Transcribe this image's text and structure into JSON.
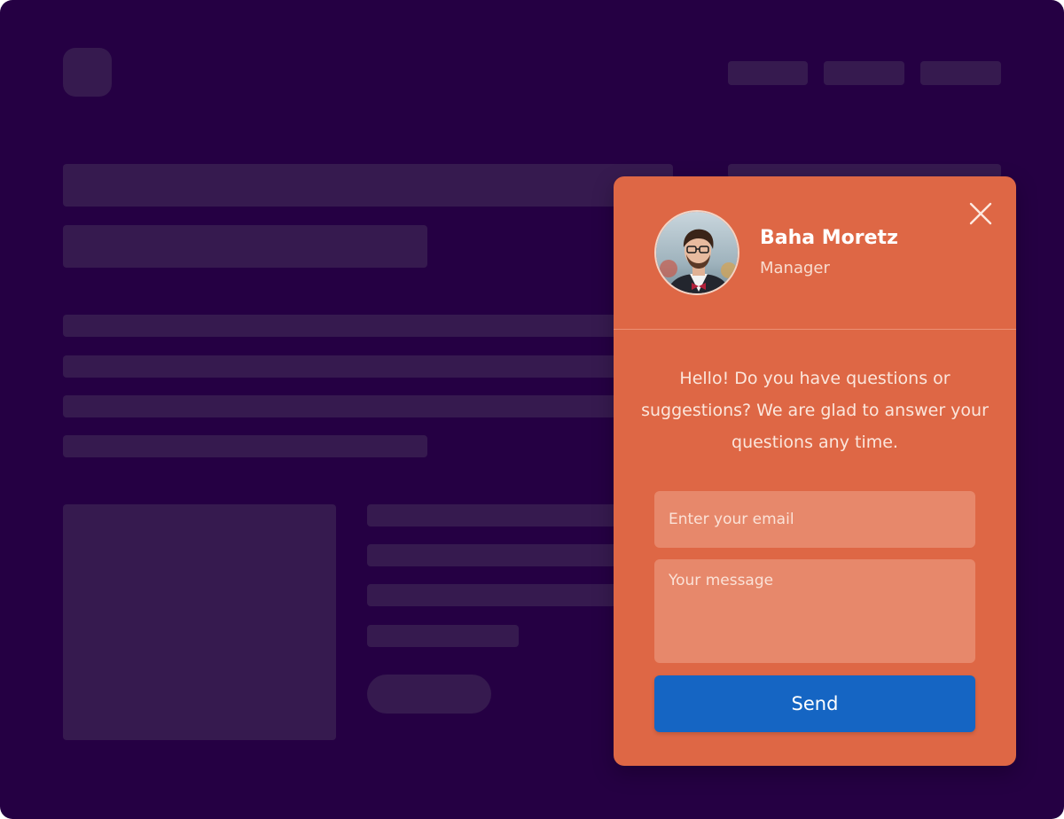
{
  "colors": {
    "background": "#250043",
    "placeholder_block": "#361a4f",
    "widget": "#de6745",
    "input": "#e7886b",
    "send_button": "#1565c3"
  },
  "chat_widget": {
    "agent": {
      "name": "Baha Moretz",
      "role": "Manager",
      "avatar_icon": "user-avatar-photo"
    },
    "close_icon": "close-icon",
    "greeting": "Hello! Do you have questions or suggestions? We are glad to answer your questions any time.",
    "email_placeholder": "Enter your email",
    "message_placeholder": "Your message",
    "send_label": "Send"
  }
}
